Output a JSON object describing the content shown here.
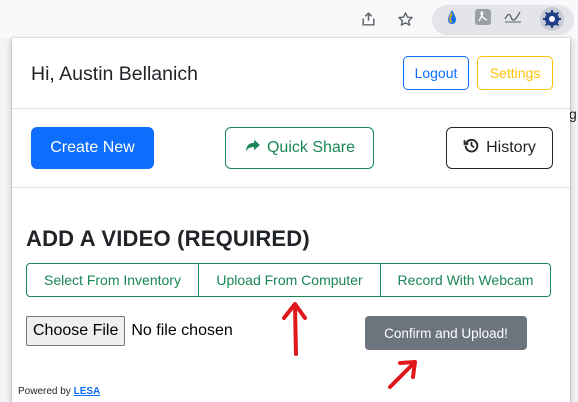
{
  "popup": {
    "greeting": "Hi, Austin Bellanich",
    "logout_label": "Logout",
    "settings_label": "Settings",
    "create_label": "Create New",
    "share_label": "Quick Share",
    "history_label": "History",
    "section_title": "ADD A VIDEO (REQUIRED)",
    "sources": [
      {
        "label": "Select From Inventory"
      },
      {
        "label": "Upload From Computer"
      },
      {
        "label": "Record With Webcam"
      }
    ],
    "choose_file_label": "Choose File",
    "file_status": "No file chosen",
    "confirm_label": "Confirm and Upload!",
    "powered_prefix": "Powered by",
    "powered_link": "LESA"
  },
  "background_text": "g",
  "icons": {
    "toolbar": [
      "share-icon",
      "star-icon",
      "droplet-extension-icon",
      "pdf-extension-icon",
      "signature-extension-icon",
      "lesa-extension-icon"
    ],
    "quick_share": "share-arrow-icon",
    "history": "history-icon"
  },
  "colors": {
    "primary": "#0d6efd",
    "success": "#198754",
    "warning": "#ffc107",
    "secondary": "#6c757d",
    "annotation": "#e0181b"
  }
}
